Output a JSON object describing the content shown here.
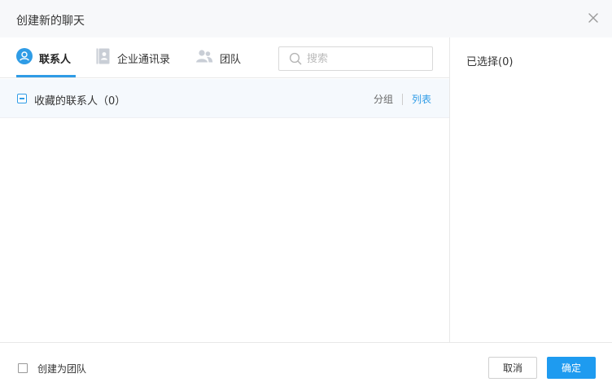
{
  "dialog": {
    "title": "创建新的聊天",
    "close_icon": "close-icon"
  },
  "tabs": [
    {
      "label": "联系人",
      "icon": "person-circle-icon",
      "active": true
    },
    {
      "label": "企业通讯录",
      "icon": "address-book-icon",
      "active": false
    },
    {
      "label": "团队",
      "icon": "group-icon",
      "active": false
    }
  ],
  "search": {
    "placeholder": "搜索",
    "value": "",
    "icon": "search-icon"
  },
  "favorites_group": {
    "title": "收藏的联系人（0）",
    "view_group_label": "分组",
    "view_list_label": "列表",
    "active_view": "列表"
  },
  "selected_panel": {
    "label": "已选择(0)"
  },
  "footer": {
    "create_team_label": "创建为团队",
    "create_team_checked": false,
    "cancel_label": "取消",
    "ok_label": "确定"
  },
  "colors": {
    "accent": "#2f9ce6",
    "primary_button": "#1e9bf0",
    "header_bg": "#f7f8fa",
    "group_row_bg": "#f5f9fd"
  }
}
